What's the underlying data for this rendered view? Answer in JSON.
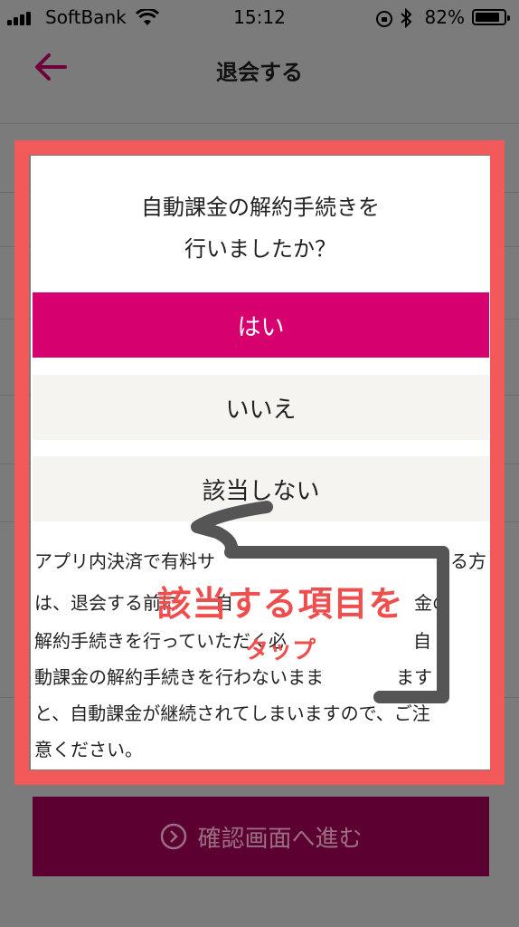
{
  "status_bar": {
    "carrier": "SoftBank",
    "time": "15:12",
    "battery": "82%"
  },
  "header": {
    "title": "退会する"
  },
  "modal": {
    "question": "自動課金の解約手続きを\n行いましたか？",
    "options": [
      {
        "label": "はい",
        "selected": true
      },
      {
        "label": "いいえ",
        "selected": false
      },
      {
        "label": "該当しない",
        "selected": false
      }
    ],
    "notice_lines": [
      "アプリ内決済で有料サ　　　　　　　　　　　　　る方",
      "は、退会する前に　　自　　　　　　　　　　金の",
      "解約手続きを行っていただく必　　　　　　　自",
      "動課金の解約手続きを行わないまま　　　　ます",
      "と、自動課金が継続されてしまいますので、ご注",
      "意ください。"
    ]
  },
  "annotation": {
    "main": "該当する項目を",
    "sub": "タップ"
  },
  "footer": {
    "confirm_label": "確認画面へ進む"
  },
  "colors": {
    "accent": "#d6006f",
    "highlight": "#f25a5a",
    "dimmed_button": "#5c0031"
  }
}
